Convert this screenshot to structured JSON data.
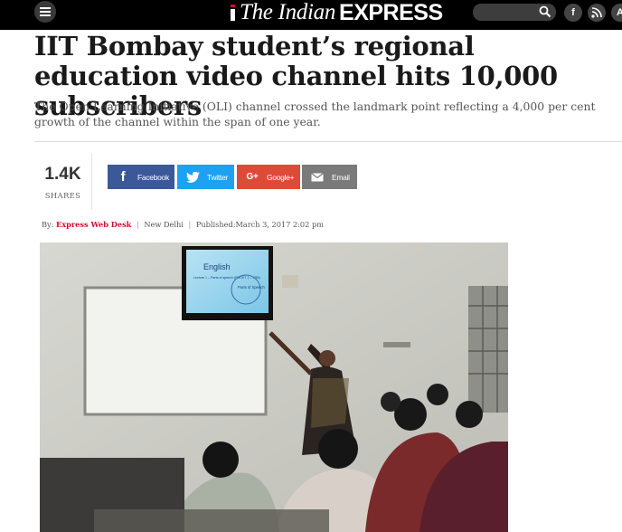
{
  "header": {
    "logo_prefix": "The Indian",
    "logo_suffix": "EXPRESS",
    "search_placeholder": "",
    "social": [
      {
        "name": "facebook",
        "glyph": "f"
      },
      {
        "name": "rss",
        "glyph": "◥"
      },
      {
        "name": "app",
        "glyph": "A"
      }
    ]
  },
  "article": {
    "headline": "IIT Bombay student’s regional education video channel hits 10,000 subscribers",
    "synopsis": "The Open Learning Initiative (OLI) channel crossed the landmark point reflecting a 4,000 per cent growth of the channel within the span of one year.",
    "shares": {
      "count": "1.4K",
      "label": "SHARES"
    },
    "share_buttons": [
      {
        "name": "facebook",
        "label": "Facebook",
        "color": "#3b5998"
      },
      {
        "name": "twitter",
        "label": "Twitter",
        "color": "#1da1f2"
      },
      {
        "name": "google-plus",
        "label": "Google+",
        "color": "#dc4a38"
      },
      {
        "name": "email",
        "label": "Email",
        "color": "#7a7a7a"
      }
    ],
    "byline": {
      "by": "By:",
      "author": "Express Web Desk",
      "location": "New Delhi",
      "published_label": "Published:",
      "published": "March 3, 2017 2:02 pm"
    },
    "image": {
      "screen_title": "English",
      "screen_sub": "Lecture 1 – Parts of speech (PGCET 1 – SSB)",
      "screen_bubble": "Parts of Speech"
    }
  },
  "colors": {
    "accent": "#c8102e",
    "topbar": "#000000"
  }
}
